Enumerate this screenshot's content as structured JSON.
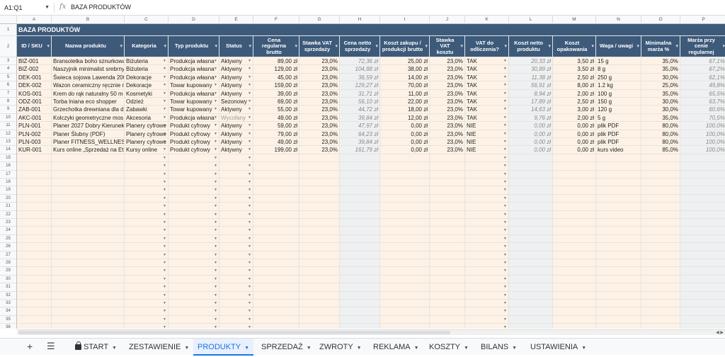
{
  "formula_bar": {
    "cell_ref": "A1:Q1",
    "fx": "fx",
    "content": "BAZA PRODUKTÓW"
  },
  "columns": [
    "A",
    "B",
    "C",
    "D",
    "E",
    "F",
    "G",
    "H",
    "I",
    "J",
    "K",
    "L",
    "M",
    "N",
    "O",
    "P"
  ],
  "title": "BAZA PRODUKTÓW",
  "headers": [
    "ID / SKU",
    "Nazwa produktu",
    "Kategoria",
    "Typ produktu",
    "Status",
    "Cena regularna brutto",
    "Stawka VAT sprzedaży",
    "Cena netto sprzedaży",
    "Koszt zakupu / produkcji brutto",
    "Stawka VAT kosztu",
    "VAT do odliczenia?",
    "Koszt netto produktu",
    "Koszt opakowania",
    "Waga / uwagi",
    "Minimalna marża %",
    "Marża przy cenie regularnej"
  ],
  "rows": [
    [
      "BIŻ-001",
      "Bransoletka boho sznurkowa",
      "Biżuteria",
      "Produkcja własna",
      "Aktywny",
      "89,00 zł",
      "23,0%",
      "72,36 zł",
      "25,00 zł",
      "23,0%",
      "TAK",
      "20,33 zł",
      "3,50 zł",
      "15 g",
      "35,0%",
      "67,1%"
    ],
    [
      "BIŻ-002",
      "Naszyjnik minimalist srebrny",
      "Biżuteria",
      "Produkcja własna",
      "Aktywny",
      "129,00 zł",
      "23,0%",
      "104,88 zł",
      "38,00 zł",
      "23,0%",
      "TAK",
      "30,89 zł",
      "3,50 zł",
      "8 g",
      "35,0%",
      "67,2%"
    ],
    [
      "DEK-001",
      "Świeca sojowa Lawenda 200",
      "Dekoracje",
      "Produkcja własna",
      "Aktywny",
      "45,00 zł",
      "23,0%",
      "36,59 zł",
      "14,00 zł",
      "23,0%",
      "TAK",
      "11,38 zł",
      "2,50 zł",
      "250 g",
      "30,0%",
      "62,1%"
    ],
    [
      "DEK-002",
      "Wazon ceramiczny ręcznie m",
      "Dekoracje",
      "Towar kupowany",
      "Aktywny",
      "159,00 zł",
      "23,0%",
      "129,27 zł",
      "70,00 zł",
      "23,0%",
      "TAK",
      "56,91 zł",
      "8,00 zł",
      "1.2 kg",
      "25,0%",
      "49,8%"
    ],
    [
      "KOS-001",
      "Krem do rąk naturalny 50 m",
      "Kosmetyki",
      "Produkcja własna",
      "Aktywny",
      "39,00 zł",
      "23,0%",
      "31,71 zł",
      "11,00 zł",
      "23,0%",
      "TAK",
      "8,94 zł",
      "2,00 zł",
      "100 g",
      "35,0%",
      "65,5%"
    ],
    [
      "ODZ-001",
      "Torba lniana eco shopper",
      "Odzież",
      "Towar kupowany",
      "Sezonowy",
      "69,00 zł",
      "23,0%",
      "56,10 zł",
      "22,00 zł",
      "23,0%",
      "TAK",
      "17,89 zł",
      "2,50 zł",
      "150 g",
      "30,0%",
      "63,7%"
    ],
    [
      "ZAB-001",
      "Grzechotka drewniana dla d",
      "Zabawki",
      "Towar kupowany",
      "Aktywny",
      "55,00 zł",
      "23,0%",
      "44,72 zł",
      "18,00 zł",
      "23,0%",
      "TAK",
      "14,63 zł",
      "3,00 zł",
      "120 g",
      "30,0%",
      "60,6%"
    ],
    [
      "AKC-001",
      "Kolczyki geometryczne mos",
      "Akcesoria",
      "Produkcja własna",
      "Wycofany",
      "49,00 zł",
      "23,0%",
      "39,84 zł",
      "12,00 zł",
      "23,0%",
      "TAK",
      "9,76 zł",
      "2,00 zł",
      "5 g",
      "35,0%",
      "70,5%"
    ],
    [
      "PLN-001",
      "Planer 2027 Dobry Kierunek",
      "Planery cyfrowe",
      "Produkt cyfrowy",
      "Aktywny",
      "59,00 zł",
      "23,0%",
      "47,97 zł",
      "0,00 zł",
      "23,0%",
      "NIE",
      "0,00 zł",
      "0,00 zł",
      "plik PDF",
      "80,0%",
      "100,0%"
    ],
    [
      "PLN-002",
      "Planer Ślubny (PDF)",
      "Planery cyfrowe",
      "Produkt cyfrowy",
      "Aktywny",
      "79,00 zł",
      "23,0%",
      "64,23 zł",
      "0,00 zł",
      "23,0%",
      "NIE",
      "0,00 zł",
      "0,00 zł",
      "plik PDF",
      "80,0%",
      "100,0%"
    ],
    [
      "PLN-003",
      "Planer FITNESS_WELLNESS",
      "Planery cyfrowe",
      "Produkt cyfrowy",
      "Aktywny",
      "49,00 zł",
      "23,0%",
      "39,84 zł",
      "0,00 zł",
      "23,0%",
      "NIE",
      "0,00 zł",
      "0,00 zł",
      "plik PDF",
      "80,0%",
      "100,0%"
    ],
    [
      "KUR-001",
      "Kurs online „Sprzedaż na Et",
      "Kursy online",
      "Produkt cyfrowy",
      "Aktywny",
      "199,00 zł",
      "23,0%",
      "161,79 zł",
      "0,00 zł",
      "23,0%",
      "NIE",
      "0,00 zł",
      "0,00 zł",
      "kurs video",
      "85,0%",
      "100,0%"
    ]
  ],
  "empty_row_start": 15,
  "empty_row_end": 36,
  "tabs": [
    {
      "label": "START",
      "locked": true
    },
    {
      "label": "ZESTAWIENIE"
    },
    {
      "label": "PRODUKTY",
      "active": true
    },
    {
      "label": "SPRZEDAŻ"
    },
    {
      "label": "ZWROTY"
    },
    {
      "label": "REKLAMA"
    },
    {
      "label": "KOSZTY"
    },
    {
      "label": "BILANS"
    },
    {
      "label": "USTAWIENIA"
    }
  ]
}
